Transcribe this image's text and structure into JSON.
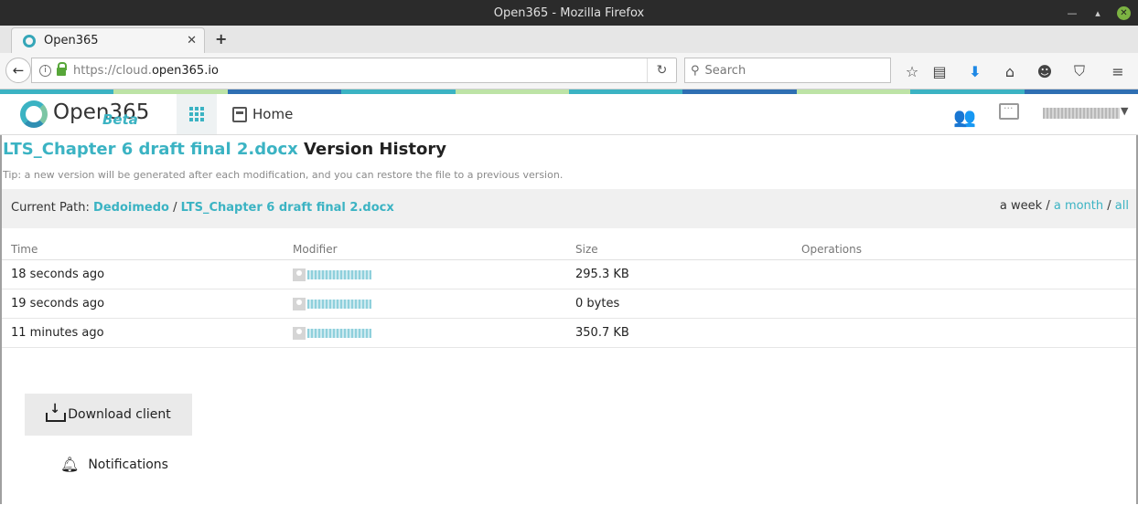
{
  "window": {
    "title": "Open365 - Mozilla Firefox"
  },
  "browser": {
    "tab_title": "Open365",
    "url_prefix": "https://cloud.",
    "url_host": "open365.io",
    "search_placeholder": "Search"
  },
  "colors": {
    "accent": "#3bb3c3",
    "strip": [
      "#3bb3c3",
      "#bde3a6",
      "#2f6fb3",
      "#3bb3c3",
      "#bde3a6",
      "#3bb3c3",
      "#2f6fb3",
      "#bde3a6",
      "#3bb3c3",
      "#2f6fb3"
    ]
  },
  "app": {
    "logo_text": "Open365",
    "logo_badge": "Beta",
    "home_label": "Home"
  },
  "page": {
    "title_file": "LTS_Chapter 6 draft final 2.docx",
    "title_suffix": " Version History",
    "tip": "Tip: a new version will be generated after each modification, and you can restore the file to a previous version.",
    "path_label": "Current Path: ",
    "path_root": "Dedoimedo",
    "path_sep": " / ",
    "path_file": "LTS_Chapter 6 draft final 2.docx",
    "filter_week": "a week",
    "filter_month": "a month",
    "filter_all": "all",
    "filter_sep": " / "
  },
  "table": {
    "headers": [
      "Time",
      "Modifier",
      "Size",
      "Operations"
    ],
    "rows": [
      {
        "time": "18 seconds ago",
        "size": "295.3 KB"
      },
      {
        "time": "19 seconds ago",
        "size": "0 bytes"
      },
      {
        "time": "11 minutes ago",
        "size": "350.7 KB"
      }
    ]
  },
  "sidebar": {
    "download_label": "Download client",
    "notifications_label": "Notifications"
  }
}
